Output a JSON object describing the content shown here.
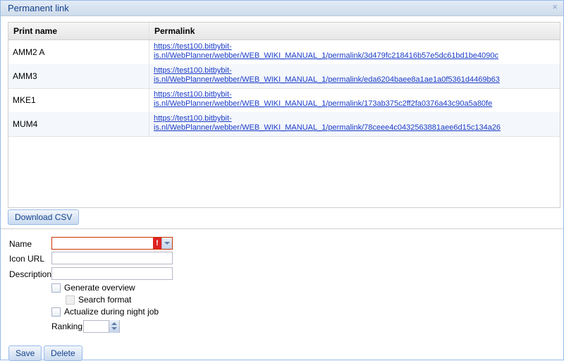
{
  "dialog": {
    "title": "Permanent link",
    "close_icon": "close-icon",
    "close_glyph": "×"
  },
  "grid": {
    "columns": [
      "Print name",
      "Permalink"
    ],
    "rows": [
      {
        "name": "AMM2 A",
        "link_line1": "https://test100.bitbybit-",
        "link_line2": "is.nl/WebPlanner/webber/WEB_WIKI_MANUAL_1/permalink/3d479fc218416b57e5dc61bd1be4090c"
      },
      {
        "name": "AMM3",
        "link_line1": "https://test100.bitbybit-",
        "link_line2": "is.nl/WebPlanner/webber/WEB_WIKI_MANUAL_1/permalink/eda6204baee8a1ae1a0f5361d4469b63"
      },
      {
        "name": "MKE1",
        "link_line1": "https://test100.bitbybit-",
        "link_line2": "is.nl/WebPlanner/webber/WEB_WIKI_MANUAL_1/permalink/173ab375c2ff2fa0376a43c90a5a80fe"
      },
      {
        "name": "MUM4",
        "link_line1": "https://test100.bitbybit-",
        "link_line2": "is.nl/WebPlanner/webber/WEB_WIKI_MANUAL_1/permalink/78ceee4c0432563881aee6d15c134a26"
      }
    ]
  },
  "buttons": {
    "download_csv": "Download CSV",
    "save": "Save",
    "delete": "Delete"
  },
  "form": {
    "name_label": "Name",
    "name_value": "",
    "name_error_glyph": "!",
    "icon_url_label": "Icon URL",
    "icon_url_value": "",
    "description_label": "Description",
    "description_value": "",
    "generate_overview_label": "Generate overview",
    "search_format_label": "Search format",
    "actualize_label": "Actualize during night job",
    "ranking_label": "Ranking",
    "ranking_value": ""
  },
  "colors": {
    "accent": "#99bbe8",
    "link": "#1a3cc8",
    "error": "#dd2222"
  }
}
